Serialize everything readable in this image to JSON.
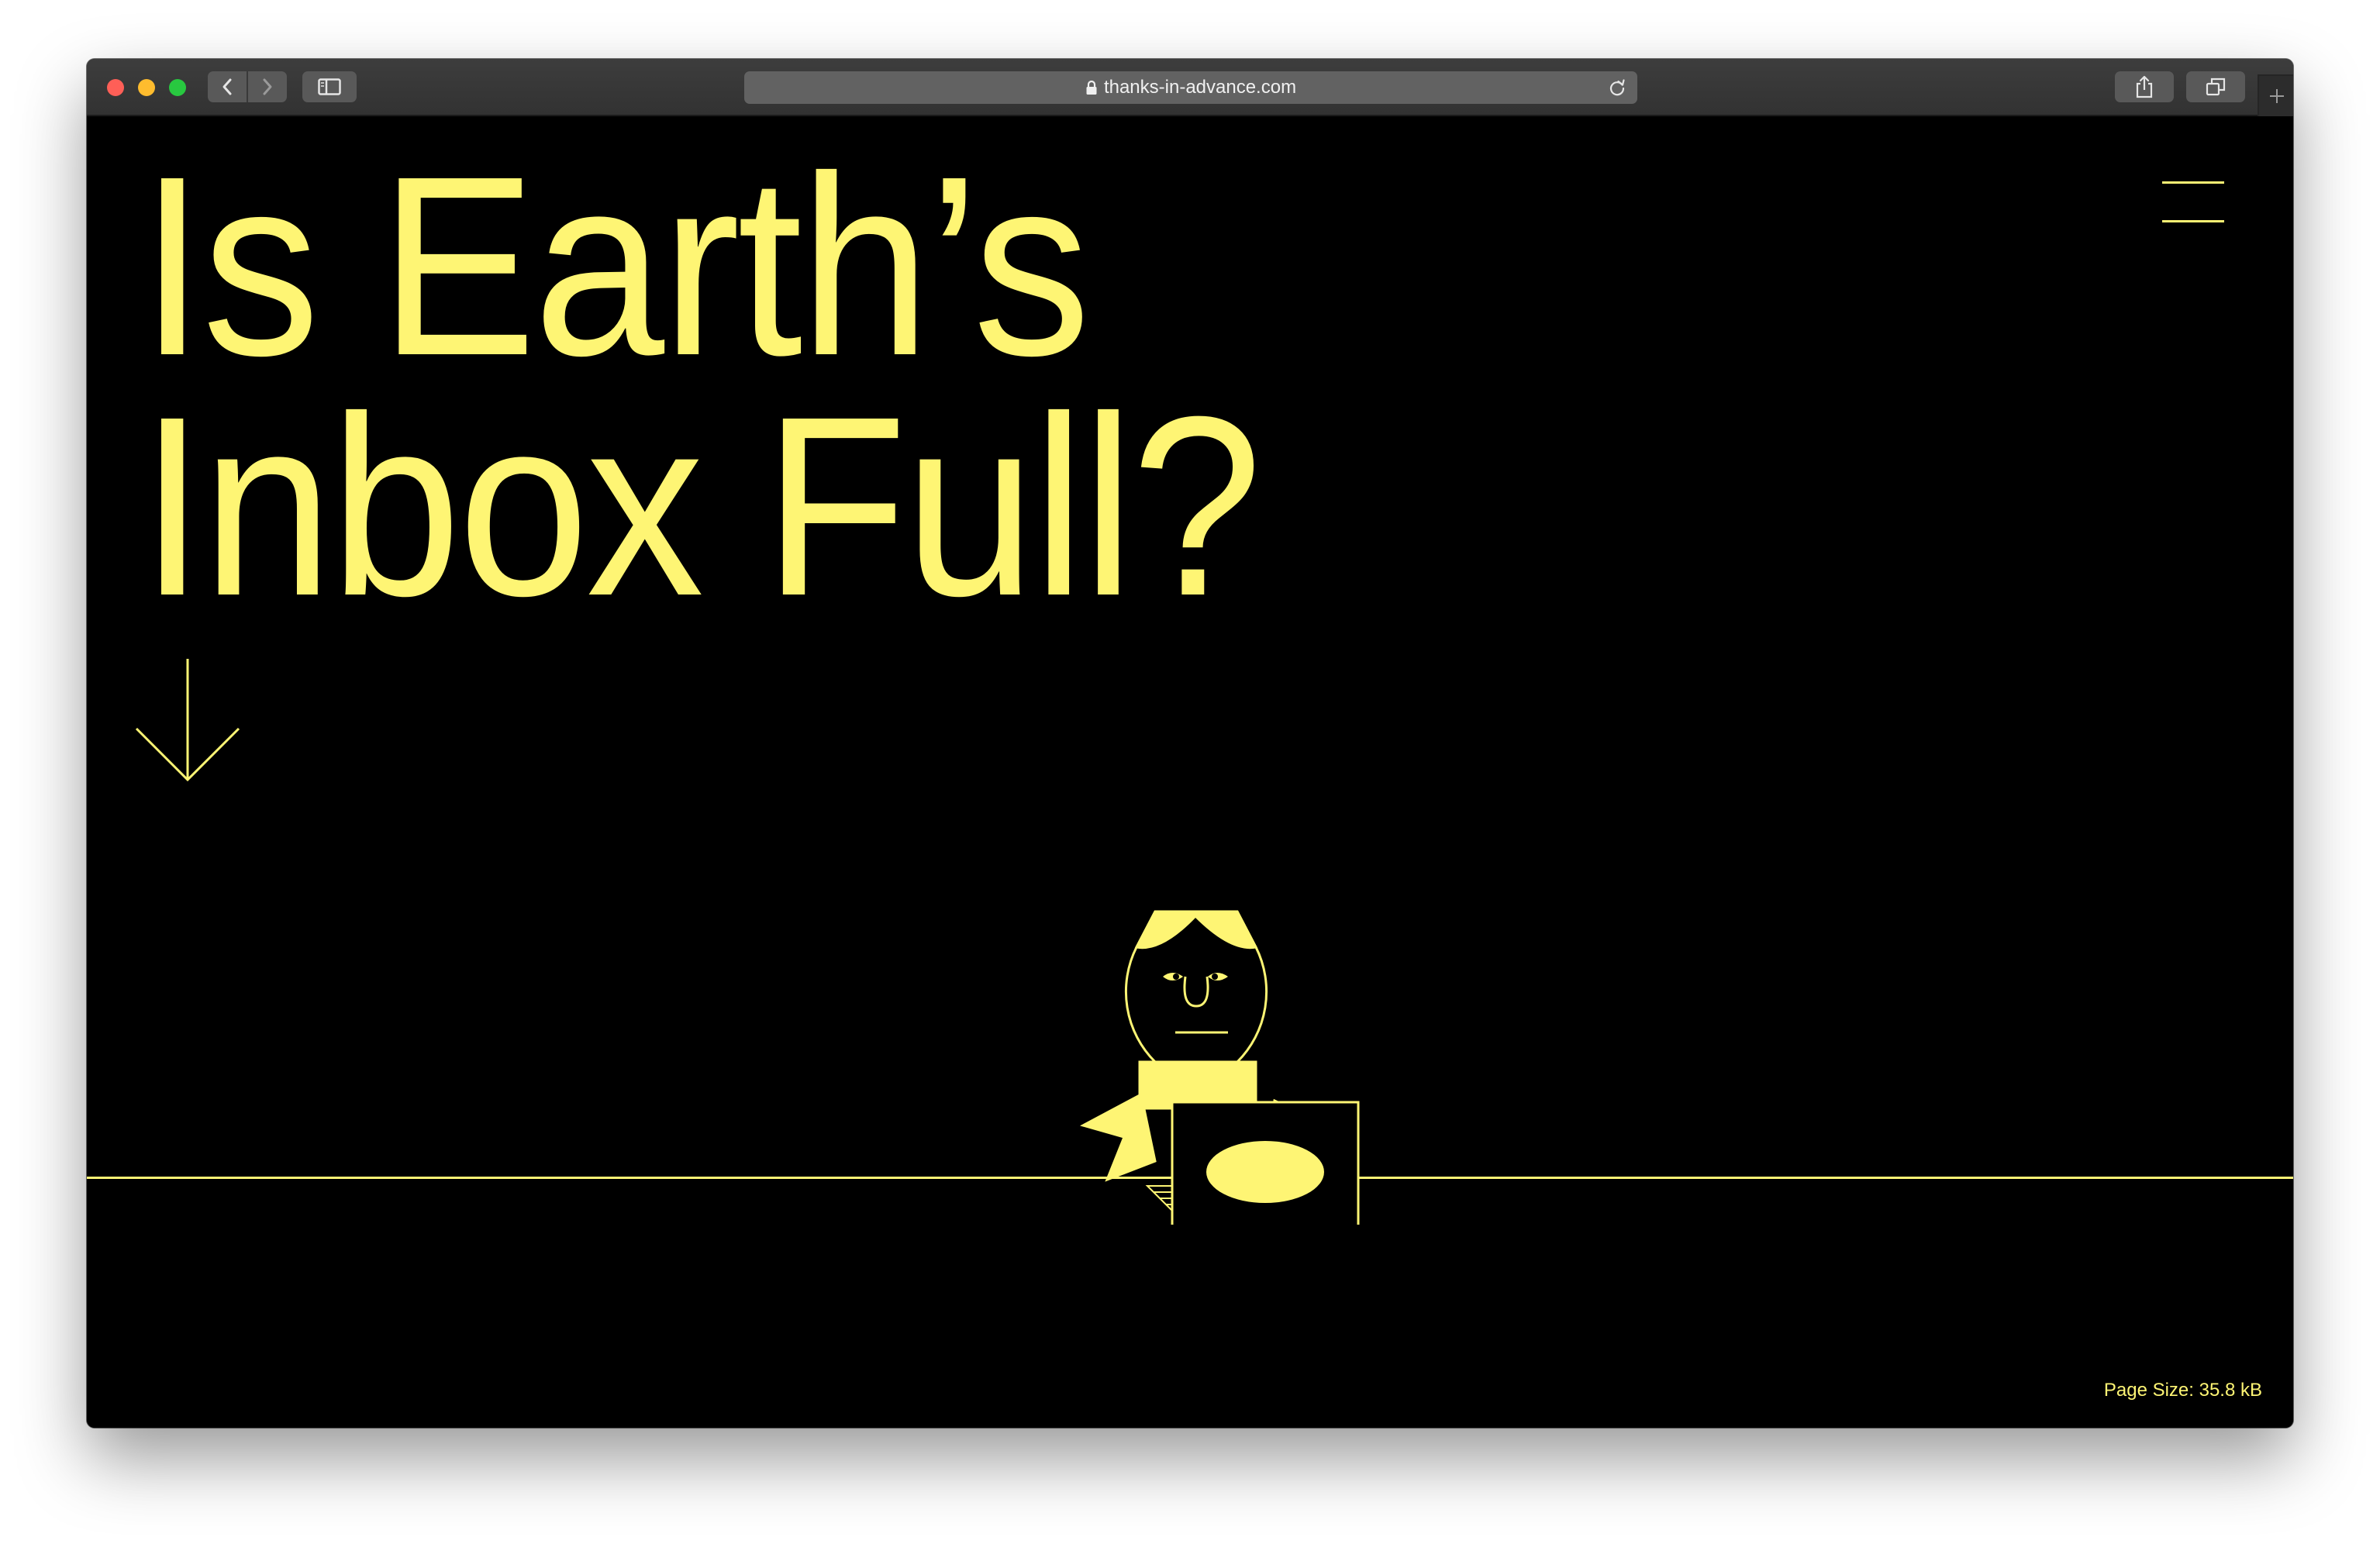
{
  "browser": {
    "url": "thanks-in-advance.com"
  },
  "page": {
    "headline": "Is Earth’s\nInbox Full?",
    "footer_page_size": "Page Size: 35.8 kB"
  },
  "icons": {
    "back": "chevron-left-icon",
    "forward": "chevron-right-icon",
    "sidebar": "sidebar-icon",
    "share": "share-icon",
    "tabs": "tab-overview-icon",
    "new_tab": "plus-icon",
    "lock": "lock-icon",
    "reload": "reload-icon",
    "menu": "hamburger-menu-icon",
    "scroll": "arrow-down-icon",
    "illustration": "person-with-mailbox-illustration"
  },
  "colors": {
    "accent": "#fef574",
    "background": "#000000",
    "chrome": "#363636"
  }
}
